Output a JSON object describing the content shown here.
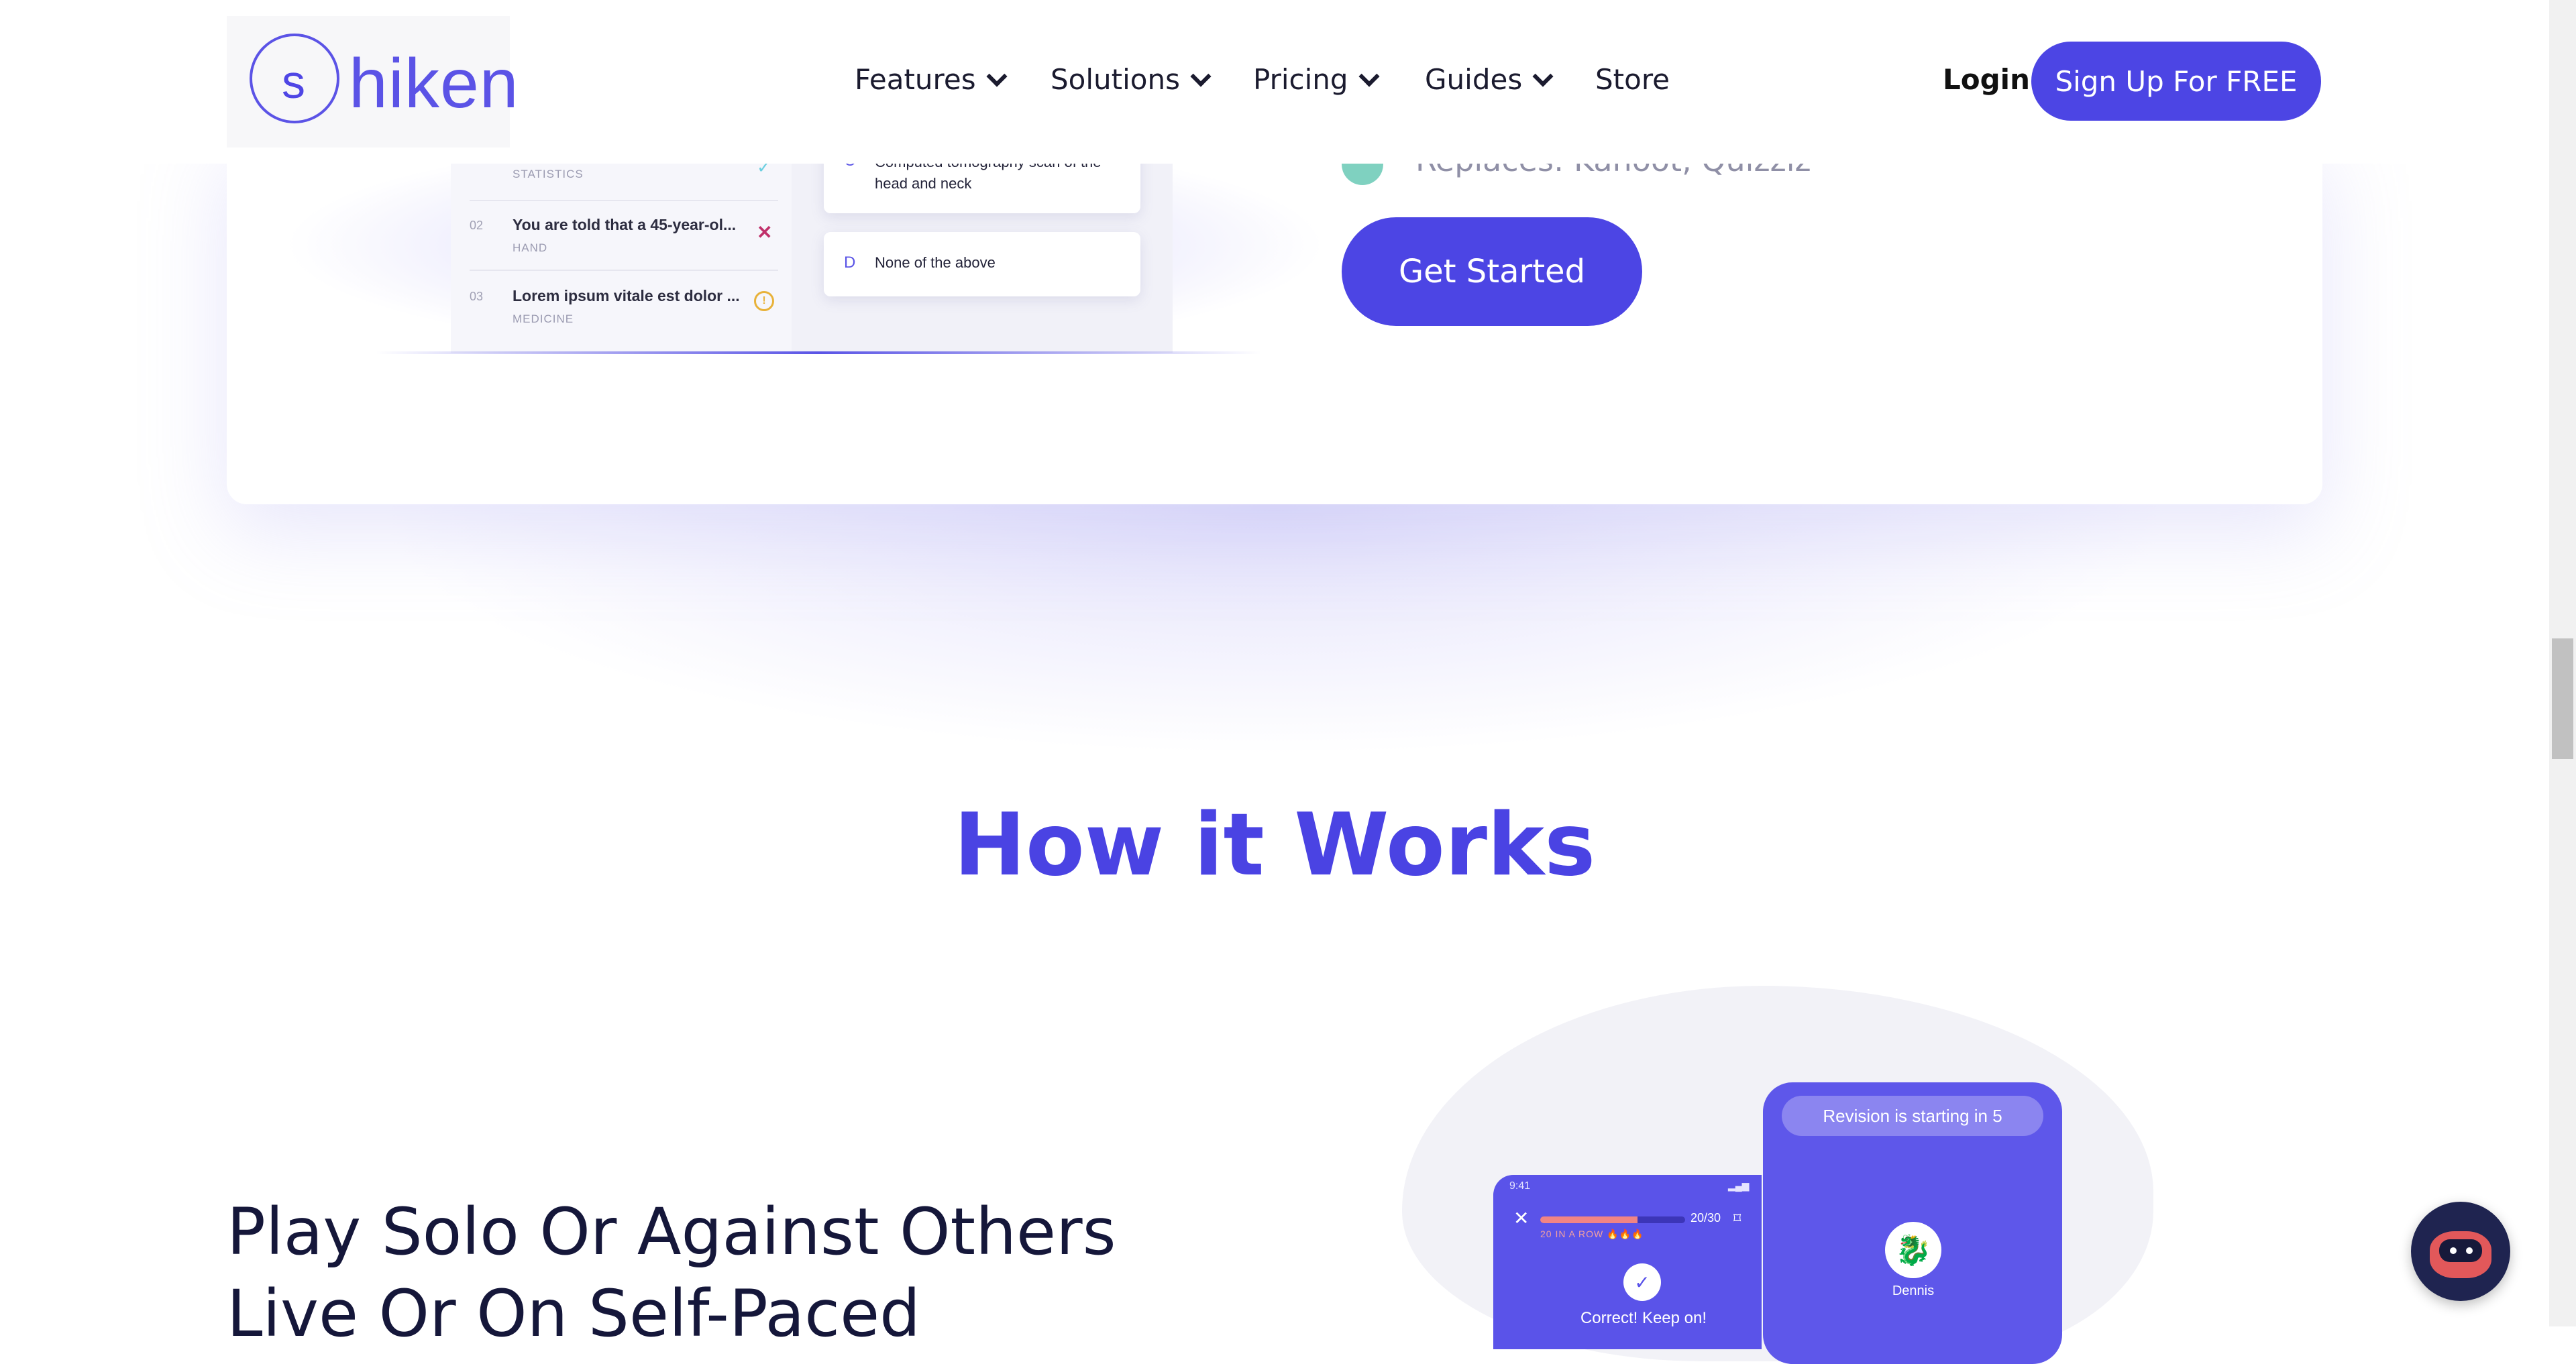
{
  "header": {
    "logo_letter": "s",
    "logo_text": "hiken",
    "nav": [
      {
        "label": "Features",
        "icon": "chevron-down-icon"
      },
      {
        "label": "Solutions",
        "icon": "chevron-down-icon"
      },
      {
        "label": "Pricing",
        "icon": "chevron-down-icon"
      },
      {
        "label": "Guides",
        "icon": "chevron-down-icon"
      },
      {
        "label": "Store"
      }
    ],
    "login_label": "Login",
    "signup_label": "Sign Up For FREE",
    "accent": "#4c45e4"
  },
  "quiz_preview": {
    "questions": [
      {
        "num": "",
        "title": "",
        "tag": "STATISTICS",
        "status_icon": "check-icon"
      },
      {
        "num": "02",
        "title": "You are told that a 45-year-ol...",
        "tag": "HAND",
        "status_icon": "cross-icon"
      },
      {
        "num": "03",
        "title": "Lorem ipsum vitale est dolor ...",
        "tag": "MEDICINE",
        "status_icon": "warning-icon"
      }
    ],
    "answers": [
      {
        "letter": "C",
        "text": "Computed tomography scan of the head and neck"
      },
      {
        "letter": "D",
        "text": "None of the above"
      }
    ]
  },
  "feature": {
    "replaces_text": "Replaces: Kahoot, Quizziz",
    "get_started_label": "Get Started"
  },
  "how_it_works": {
    "title": "How it Works",
    "step_title_line1": "Play Solo Or Against Others",
    "step_title_line2": "Live Or On Self-Paced"
  },
  "phones": {
    "back": {
      "pill_text": "Revision is starting in 5",
      "player_name": "Dennis"
    },
    "front": {
      "time": "9:41",
      "progress_count": "20/30",
      "progress_fraction": 0.67,
      "streak_text": "20 IN A ROW 🔥🔥🔥",
      "feedback_text": "Correct! Keep on!"
    }
  }
}
